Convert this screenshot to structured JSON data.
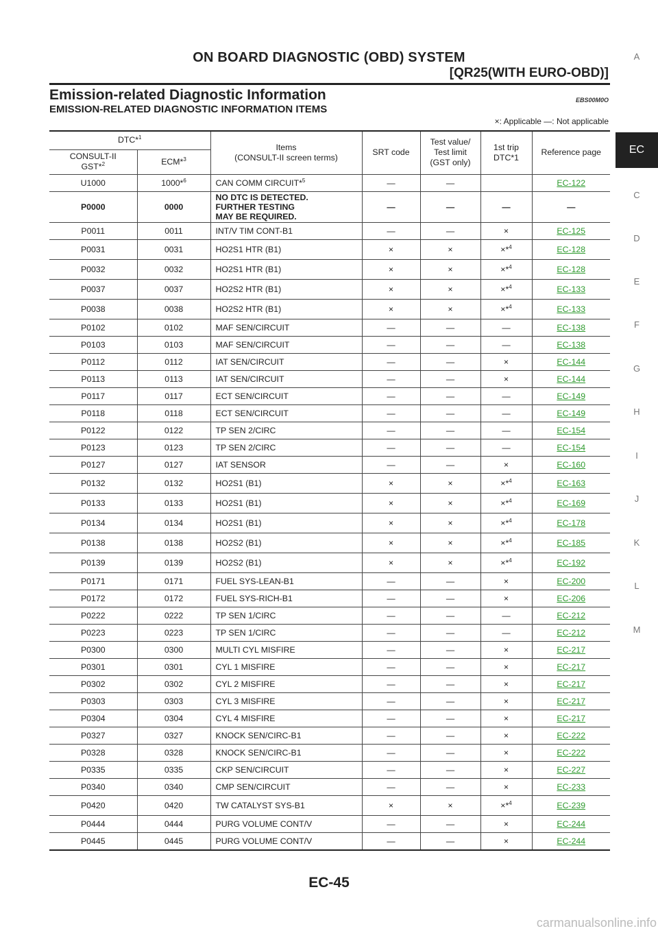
{
  "header": {
    "title": "ON BOARD DIAGNOSTIC (OBD) SYSTEM",
    "subtitle": "[QR25(WITH EURO-OBD)]"
  },
  "section": {
    "title": "Emission-related Diagnostic Information",
    "code": "EBS00M0O",
    "subtitle": "EMISSION-RELATED DIAGNOSTIC INFORMATION ITEMS",
    "legend": "×: Applicable    —: Not applicable"
  },
  "side_tabs": [
    "A",
    "EC",
    "C",
    "D",
    "E",
    "F",
    "G",
    "H",
    "I",
    "J",
    "K",
    "L",
    "M"
  ],
  "table": {
    "headers": {
      "dtc": "DTC*",
      "dtc_sup": "1",
      "consult": "CONSULT-II",
      "gst": "GST*",
      "gst_sup": "2",
      "ecm": "ECM*",
      "ecm_sup": "3",
      "items_l1": "Items",
      "items_l2": "(CONSULT-II screen terms)",
      "srt": "SRT code",
      "test_l1": "Test value/",
      "test_l2": "Test limit",
      "test_l3": "(GST only)",
      "trip_l1": "1st trip",
      "trip_l2": "DTC*1",
      "ref": "Reference page"
    },
    "rows": [
      {
        "c": "U1000",
        "e": "1000*",
        "es": "6",
        "i": "CAN COMM CIRCUIT*",
        "is": "5",
        "s": "—",
        "t": "—",
        "f": "",
        "fs": "",
        "r": "EC-122"
      },
      {
        "c": "P0000",
        "e": "0000",
        "i": "NO DTC IS DETECTED.",
        "i2": "FURTHER TESTING",
        "i3": "MAY BE REQUIRED.",
        "s": "—",
        "t": "—",
        "f": "—",
        "fs": "",
        "r": "—",
        "bold": true
      },
      {
        "c": "P0011",
        "e": "0011",
        "i": "INT/V TIM CONT-B1",
        "s": "—",
        "t": "—",
        "f": "×",
        "fs": "",
        "r": "EC-125"
      },
      {
        "c": "P0031",
        "e": "0031",
        "i": "HO2S1 HTR (B1)",
        "s": "×",
        "t": "×",
        "f": "×*",
        "fs": "4",
        "r": "EC-128"
      },
      {
        "c": "P0032",
        "e": "0032",
        "i": "HO2S1 HTR (B1)",
        "s": "×",
        "t": "×",
        "f": "×*",
        "fs": "4",
        "r": "EC-128"
      },
      {
        "c": "P0037",
        "e": "0037",
        "i": "HO2S2 HTR (B1)",
        "s": "×",
        "t": "×",
        "f": "×*",
        "fs": "4",
        "r": "EC-133"
      },
      {
        "c": "P0038",
        "e": "0038",
        "i": "HO2S2 HTR (B1)",
        "s": "×",
        "t": "×",
        "f": "×*",
        "fs": "4",
        "r": "EC-133"
      },
      {
        "c": "P0102",
        "e": "0102",
        "i": "MAF SEN/CIRCUIT",
        "s": "—",
        "t": "—",
        "f": "—",
        "fs": "",
        "r": "EC-138"
      },
      {
        "c": "P0103",
        "e": "0103",
        "i": "MAF SEN/CIRCUIT",
        "s": "—",
        "t": "—",
        "f": "—",
        "fs": "",
        "r": "EC-138"
      },
      {
        "c": "P0112",
        "e": "0112",
        "i": "IAT SEN/CIRCUIT",
        "s": "—",
        "t": "—",
        "f": "×",
        "fs": "",
        "r": "EC-144"
      },
      {
        "c": "P0113",
        "e": "0113",
        "i": "IAT SEN/CIRCUIT",
        "s": "—",
        "t": "—",
        "f": "×",
        "fs": "",
        "r": "EC-144"
      },
      {
        "c": "P0117",
        "e": "0117",
        "i": "ECT SEN/CIRCUIT",
        "s": "—",
        "t": "—",
        "f": "—",
        "fs": "",
        "r": "EC-149"
      },
      {
        "c": "P0118",
        "e": "0118",
        "i": "ECT SEN/CIRCUIT",
        "s": "—",
        "t": "—",
        "f": "—",
        "fs": "",
        "r": "EC-149"
      },
      {
        "c": "P0122",
        "e": "0122",
        "i": "TP SEN 2/CIRC",
        "s": "—",
        "t": "—",
        "f": "—",
        "fs": "",
        "r": "EC-154"
      },
      {
        "c": "P0123",
        "e": "0123",
        "i": "TP SEN 2/CIRC",
        "s": "—",
        "t": "—",
        "f": "—",
        "fs": "",
        "r": "EC-154"
      },
      {
        "c": "P0127",
        "e": "0127",
        "i": "IAT SENSOR",
        "s": "—",
        "t": "—",
        "f": "×",
        "fs": "",
        "r": "EC-160"
      },
      {
        "c": "P0132",
        "e": "0132",
        "i": "HO2S1 (B1)",
        "s": "×",
        "t": "×",
        "f": "×*",
        "fs": "4",
        "r": "EC-163"
      },
      {
        "c": "P0133",
        "e": "0133",
        "i": "HO2S1 (B1)",
        "s": "×",
        "t": "×",
        "f": "×*",
        "fs": "4",
        "r": "EC-169"
      },
      {
        "c": "P0134",
        "e": "0134",
        "i": "HO2S1 (B1)",
        "s": "×",
        "t": "×",
        "f": "×*",
        "fs": "4",
        "r": "EC-178"
      },
      {
        "c": "P0138",
        "e": "0138",
        "i": "HO2S2 (B1)",
        "s": "×",
        "t": "×",
        "f": "×*",
        "fs": "4",
        "r": "EC-185"
      },
      {
        "c": "P0139",
        "e": "0139",
        "i": "HO2S2 (B1)",
        "s": "×",
        "t": "×",
        "f": "×*",
        "fs": "4",
        "r": "EC-192"
      },
      {
        "c": "P0171",
        "e": "0171",
        "i": "FUEL SYS-LEAN-B1",
        "s": "—",
        "t": "—",
        "f": "×",
        "fs": "",
        "r": "EC-200"
      },
      {
        "c": "P0172",
        "e": "0172",
        "i": "FUEL SYS-RICH-B1",
        "s": "—",
        "t": "—",
        "f": "×",
        "fs": "",
        "r": "EC-206"
      },
      {
        "c": "P0222",
        "e": "0222",
        "i": "TP SEN 1/CIRC",
        "s": "—",
        "t": "—",
        "f": "—",
        "fs": "",
        "r": "EC-212"
      },
      {
        "c": "P0223",
        "e": "0223",
        "i": "TP SEN 1/CIRC",
        "s": "—",
        "t": "—",
        "f": "—",
        "fs": "",
        "r": "EC-212"
      },
      {
        "c": "P0300",
        "e": "0300",
        "i": "MULTI CYL MISFIRE",
        "s": "—",
        "t": "—",
        "f": "×",
        "fs": "",
        "r": "EC-217"
      },
      {
        "c": "P0301",
        "e": "0301",
        "i": "CYL 1 MISFIRE",
        "s": "—",
        "t": "—",
        "f": "×",
        "fs": "",
        "r": "EC-217"
      },
      {
        "c": "P0302",
        "e": "0302",
        "i": "CYL 2 MISFIRE",
        "s": "—",
        "t": "—",
        "f": "×",
        "fs": "",
        "r": "EC-217"
      },
      {
        "c": "P0303",
        "e": "0303",
        "i": "CYL 3 MISFIRE",
        "s": "—",
        "t": "—",
        "f": "×",
        "fs": "",
        "r": "EC-217"
      },
      {
        "c": "P0304",
        "e": "0304",
        "i": "CYL 4 MISFIRE",
        "s": "—",
        "t": "—",
        "f": "×",
        "fs": "",
        "r": "EC-217"
      },
      {
        "c": "P0327",
        "e": "0327",
        "i": "KNOCK SEN/CIRC-B1",
        "s": "—",
        "t": "—",
        "f": "×",
        "fs": "",
        "r": "EC-222"
      },
      {
        "c": "P0328",
        "e": "0328",
        "i": "KNOCK SEN/CIRC-B1",
        "s": "—",
        "t": "—",
        "f": "×",
        "fs": "",
        "r": "EC-222"
      },
      {
        "c": "P0335",
        "e": "0335",
        "i": "CKP SEN/CIRCUIT",
        "s": "—",
        "t": "—",
        "f": "×",
        "fs": "",
        "r": "EC-227"
      },
      {
        "c": "P0340",
        "e": "0340",
        "i": "CMP SEN/CIRCUIT",
        "s": "—",
        "t": "—",
        "f": "×",
        "fs": "",
        "r": "EC-233"
      },
      {
        "c": "P0420",
        "e": "0420",
        "i": "TW CATALYST SYS-B1",
        "s": "×",
        "t": "×",
        "f": "×*",
        "fs": "4",
        "r": "EC-239"
      },
      {
        "c": "P0444",
        "e": "0444",
        "i": "PURG VOLUME CONT/V",
        "s": "—",
        "t": "—",
        "f": "×",
        "fs": "",
        "r": "EC-244"
      },
      {
        "c": "P0445",
        "e": "0445",
        "i": "PURG VOLUME CONT/V",
        "s": "—",
        "t": "—",
        "f": "×",
        "fs": "",
        "r": "EC-244"
      }
    ]
  },
  "footer": {
    "page_number": "EC-45",
    "watermark": "carmanualsonline.info"
  }
}
